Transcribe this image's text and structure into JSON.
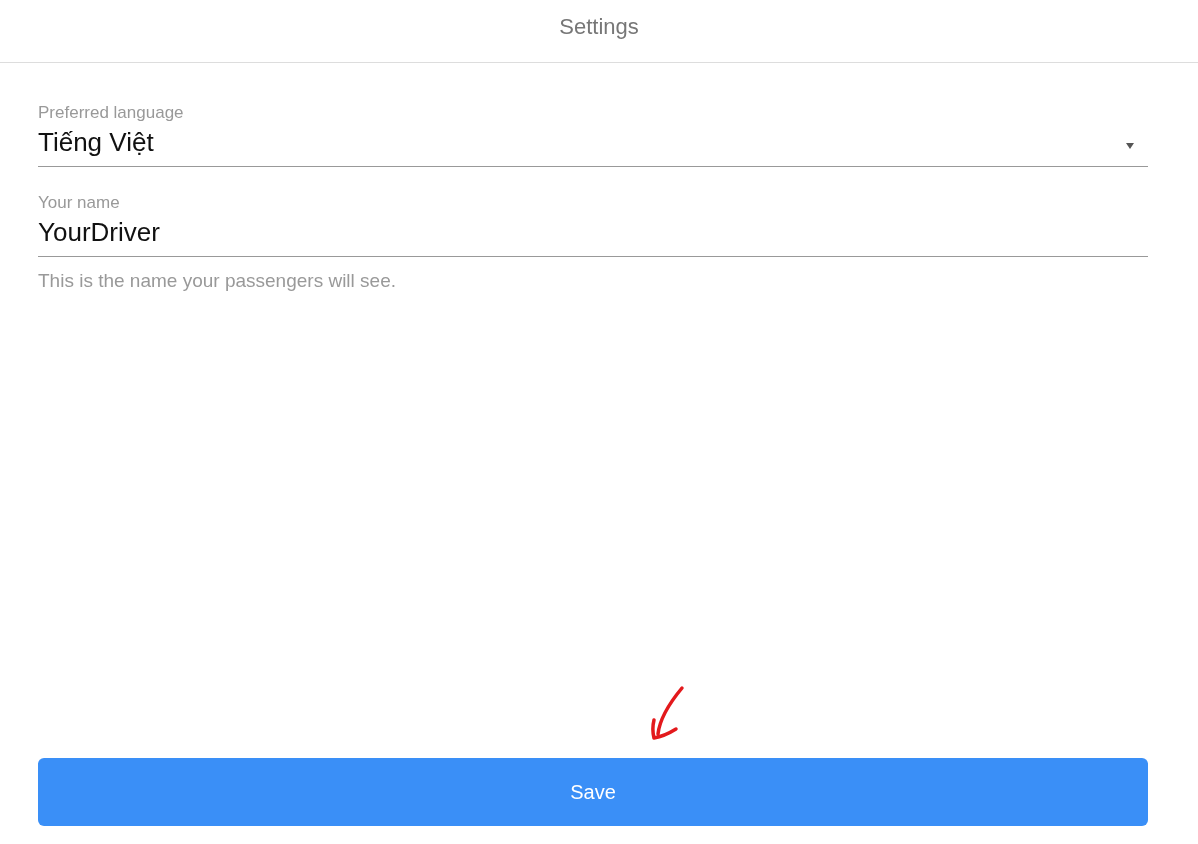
{
  "header": {
    "title": "Settings"
  },
  "fields": [
    {
      "kind": "select",
      "label": "Preferred language",
      "value": "Tiếng Việt"
    },
    {
      "kind": "text",
      "label": "Your name",
      "value": "YourDriver",
      "help": "This is the name your passengers will see."
    }
  ],
  "save_button": {
    "label": "Save"
  }
}
